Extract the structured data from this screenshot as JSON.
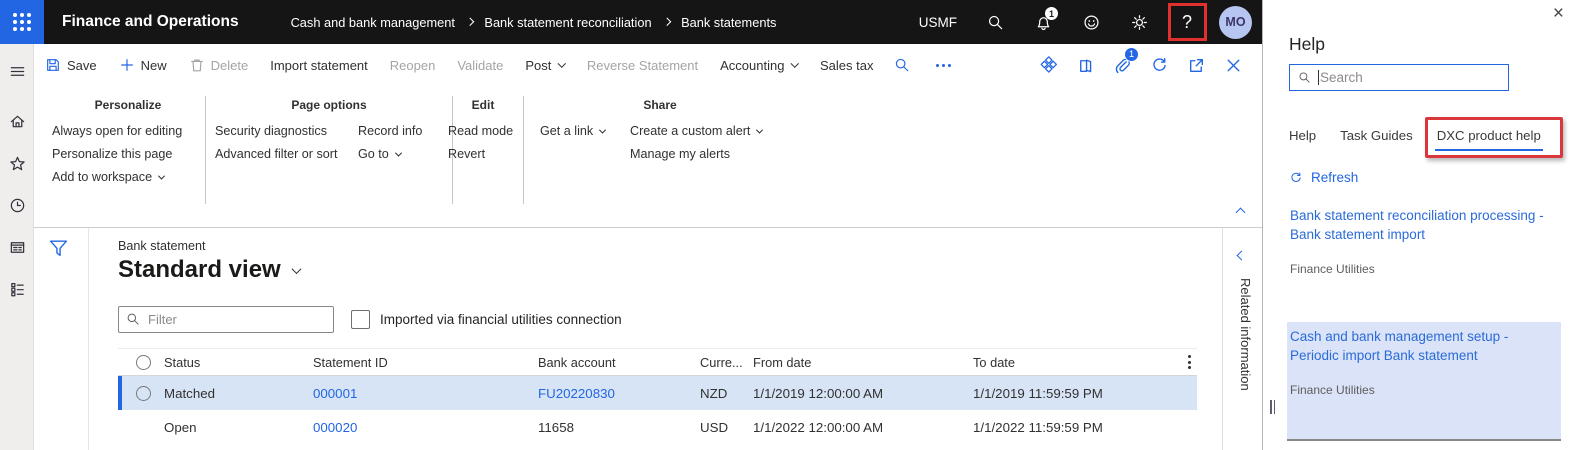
{
  "colors": {
    "accent": "#2266E3",
    "topbar_bg": "#151515",
    "annotation_red": "#D8373B",
    "selected_row_bg": "#D7E4F6",
    "help_highlight_bg": "#DAE3F8",
    "link_blue": "#2B6BD8"
  },
  "topbar": {
    "app_title": "Finance and Operations",
    "breadcrumb": [
      "Cash and bank management",
      "Bank statement reconciliation",
      "Bank statements"
    ],
    "company": "USMF",
    "bell_badge": "1",
    "avatar_initials": "MO",
    "help_button_label": "?"
  },
  "action_bar": {
    "items": [
      {
        "label": "Save"
      },
      {
        "label": "New"
      },
      {
        "label": "Delete"
      },
      {
        "label": "Import statement"
      },
      {
        "label": "Reopen"
      },
      {
        "label": "Validate"
      },
      {
        "label": "Post"
      },
      {
        "label": "Reverse Statement"
      },
      {
        "label": "Accounting"
      },
      {
        "label": "Sales tax"
      }
    ],
    "attachment_badge": "1"
  },
  "ribbon": {
    "groups": [
      {
        "title": "Personalize",
        "cols": [
          [
            "Always open for editing",
            "Personalize this page",
            "Add to workspace"
          ]
        ]
      },
      {
        "title": "Page options",
        "cols": [
          [
            "Security diagnostics",
            "Advanced filter or sort"
          ],
          [
            "Record info",
            "Go to"
          ]
        ]
      },
      {
        "title": "Edit",
        "cols": [
          [
            "Read mode",
            "Revert"
          ]
        ]
      },
      {
        "title": "Share",
        "cols": [
          [
            "Get a link"
          ],
          [
            "Create a custom alert",
            "Manage my alerts"
          ]
        ]
      }
    ]
  },
  "grid": {
    "entity_label": "Bank statement",
    "view_title": "Standard view",
    "filter_placeholder": "Filter",
    "checkbox_label": "Imported via financial utilities connection",
    "columns": [
      "Status",
      "Statement ID",
      "Bank account",
      "Curre...",
      "From date",
      "To date"
    ],
    "rows": [
      {
        "status": "Matched",
        "statement_id": "000001",
        "bank_account": "FU20220830",
        "currency": "NZD",
        "from_date": "1/1/2019 12:00:00 AM",
        "to_date": "1/1/2019 11:59:59 PM"
      },
      {
        "status": "Open",
        "statement_id": "000020",
        "bank_account": "11658",
        "currency": "USD",
        "from_date": "1/1/2022 12:00:00 AM",
        "to_date": "1/1/2022 11:59:59 PM"
      }
    ]
  },
  "related": {
    "label": "Related information"
  },
  "help": {
    "title": "Help",
    "close_label": "×",
    "search_placeholder": "Search",
    "tabs": [
      "Help",
      "Task Guides",
      "DXC product help"
    ],
    "active_tab": "DXC product help",
    "refresh_label": "Refresh",
    "articles": [
      {
        "title": "Bank statement reconciliation processing - Bank statement import",
        "source": "Finance Utilities"
      },
      {
        "title": "Cash and bank management setup - Periodic import Bank statement",
        "source": "Finance Utilities"
      }
    ]
  }
}
